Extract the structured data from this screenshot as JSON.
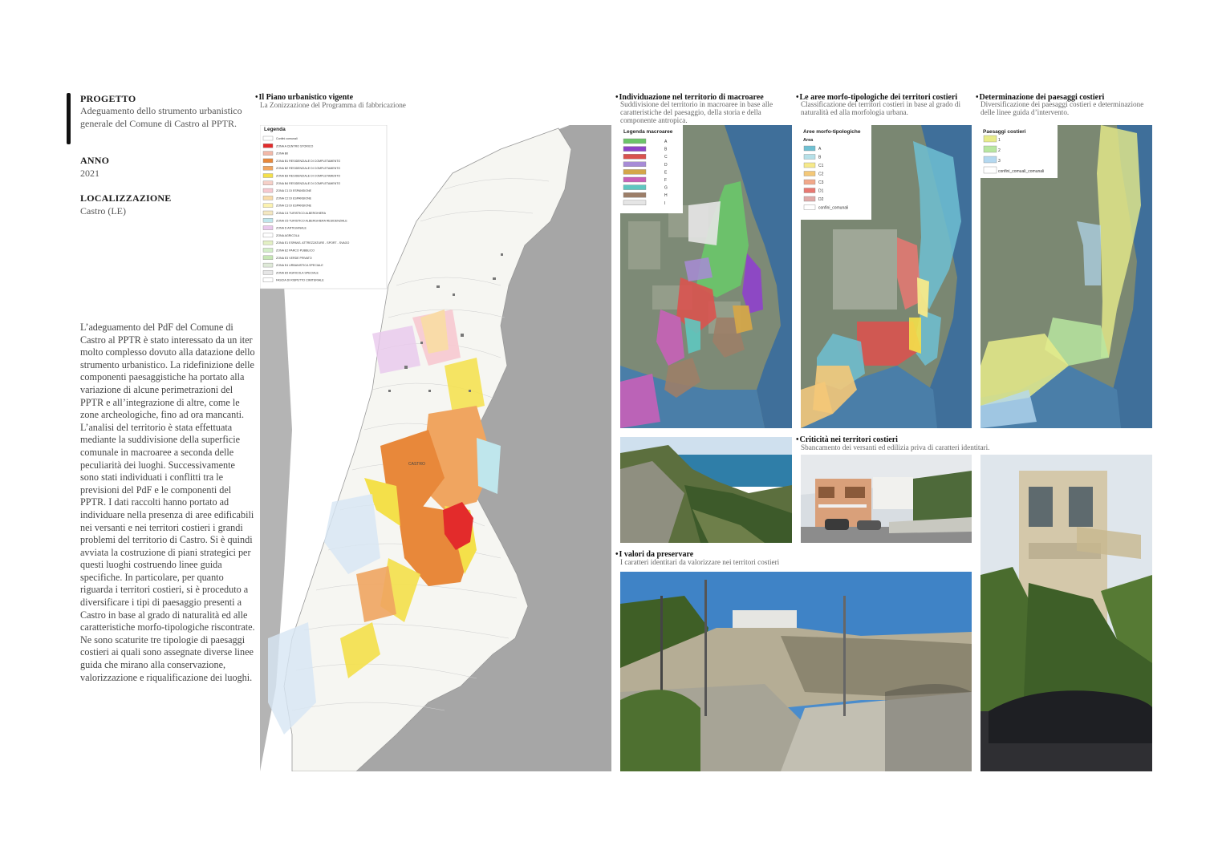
{
  "sidebar": {
    "progetto_label": "PROGETTO",
    "progetto_value": "Adeguamento dello strumento urbanistico generale del Comune di Castro al PPTR.",
    "anno_label": "ANNO",
    "anno_value": "2021",
    "localizzazione_label": "LOCALIZZAZIONE",
    "localizzazione_value": "Castro (LE)",
    "description": "L’adeguamento del PdF del Comune di Castro al PPTR è stato interessato da un iter molto complesso dovuto alla datazione dello strumento urbanistico. La ridefinizione delle componenti paesaggistiche ha portato alla variazione di alcune perimetrazioni del PPTR e all’integrazione di altre, come le zone archeologiche, fino ad ora mancanti. L’analisi del territorio è stata effettuata mediante la suddivisione della superficie comunale in macroaree a seconda delle peculiarità dei luoghi. Successivamente sono stati individuati i conflitti tra le previsioni del PdF e le componenti del PPTR. I dati raccolti hanno portato ad individuare nella presenza di aree edificabili nei versanti e nei territori costieri i grandi problemi del territorio di Castro. Si è quindi avviata la costruzione di piani strategici per questi luoghi costruendo linee guida specifiche. In particolare, per quanto riguarda i territori costieri, si è proceduto a diversificare i tipi di paesaggio presenti a Castro in base al grado di naturalità ed alle caratteristiche morfo-tipologiche riscontrate. Ne sono scaturite tre tipologie di paesaggi costieri ai quali sono assegnate diverse linee guida che mirano alla conservazione, valorizzazione e riqualificazione dei luoghi."
  },
  "piano": {
    "title": "Il Piano urbanistico vigente",
    "subtitle": "La Zonizzazione del Programma di fabbricazione",
    "legend_title": "Legenda",
    "legend_items": [
      {
        "label": "Confini comunali",
        "color": "#ffffff"
      },
      {
        "label": "ZONA A CENTRO STORICO",
        "color": "#e32b2b"
      },
      {
        "label": "ZONA B0",
        "color": "#f2b8a8"
      },
      {
        "label": "ZONA B1 RESIDENZIALE DI COMPLETAMENTO",
        "color": "#e8883a"
      },
      {
        "label": "ZONA B2 RESIDENZIALE DI COMPLETAMENTO",
        "color": "#f0a560"
      },
      {
        "label": "ZONA B3 RESIDENZIALE DI COMPLETAMENTO",
        "color": "#f4e04a"
      },
      {
        "label": "ZONA B4 RESIDENZIALE DI COMPLETAMENTO",
        "color": "#f6d0c8"
      },
      {
        "label": "ZONA C1 DI ESPANSIONE",
        "color": "#f7c9d0"
      },
      {
        "label": "ZONA C2 DI ESPANSIONE",
        "color": "#f9dba8"
      },
      {
        "label": "ZONA C3 DI ESPANSIONE",
        "color": "#fbf2b0"
      },
      {
        "label": "ZONA C4 TURISTICO ALBERGHIERA",
        "color": "#f4e8c2"
      },
      {
        "label": "ZONA C5 TURISTICO ALBERGHIERA RESIDENZIALE",
        "color": "#bfe6ec"
      },
      {
        "label": "ZONA D ARTIGIANALE",
        "color": "#e9c8ec"
      },
      {
        "label": "ZONA AGRICOLA",
        "color": "#ffffff"
      },
      {
        "label": "ZONA E1 ESPANS. ATTREZZATURE - SPORT - SVAGO",
        "color": "#e3f0c4"
      },
      {
        "label": "ZONA E2 PARCO PUBBLICO",
        "color": "#d3eec8"
      },
      {
        "label": "ZONA E3 VERDE PRIVATO",
        "color": "#c6e6b4"
      },
      {
        "label": "ZONA E4 URBANISTICA SPECIALE",
        "color": "#dfead8"
      },
      {
        "label": "ZONA E5 AGRICOLA SPECIALE",
        "color": "#e6e6e6"
      },
      {
        "label": "FASCIA DI RISPETTO CIMITERIALE",
        "color": "#ffffff"
      }
    ],
    "map_label": "CASTRO"
  },
  "macroaree": {
    "title": "Individuazione nel territorio di macroaree",
    "subtitle": "Suddivisione del territorio in macroaree in base alle caratteristiche del paesaggio, della storia e della componente  antropica.",
    "legend_title": "Legenda macroaree",
    "legend_items": [
      {
        "label": "A",
        "color": "#6cc46a"
      },
      {
        "label": "B",
        "color": "#8e44c8"
      },
      {
        "label": "C",
        "color": "#d9534f"
      },
      {
        "label": "D",
        "color": "#a78bd6"
      },
      {
        "label": "E",
        "color": "#d4a64a"
      },
      {
        "label": "F",
        "color": "#c860b8"
      },
      {
        "label": "G",
        "color": "#5fc6c0"
      },
      {
        "label": "H",
        "color": "#9c7e68"
      },
      {
        "label": "I",
        "color": "#e5e5e5"
      }
    ]
  },
  "aree": {
    "title": "Le aree morfo-tipologiche dei territori costieri",
    "subtitle": "Classificazione dei territori costieri in base al grado di naturalità ed alla morfologia urbana.",
    "legend_title": "Aree morfo-tipologiche",
    "legend_subtitle": "Area",
    "legend_items": [
      {
        "label": "A",
        "color": "#6fc0d2"
      },
      {
        "label": "B",
        "color": "#b6e0e8"
      },
      {
        "label": "C1",
        "color": "#f6e98a"
      },
      {
        "label": "C2",
        "color": "#f4c878"
      },
      {
        "label": "C3",
        "color": "#f2a88a"
      },
      {
        "label": "D1",
        "color": "#e87872"
      },
      {
        "label": "D2",
        "color": "#e0aaa8"
      },
      {
        "label": "confini_comunali",
        "color": "#ffffff"
      }
    ]
  },
  "paesaggi": {
    "title": "Determinazione dei paesaggi costieri",
    "subtitle": "Diversificazione dei paesaggi costieri e determinazione delle linee guida d’intervento.",
    "legend_title": "Paesaggi costieri",
    "legend_items": [
      {
        "label": "1",
        "color": "#e8ec8a"
      },
      {
        "label": "2",
        "color": "#b8e6a0"
      },
      {
        "label": "3",
        "color": "#b4d8f0"
      },
      {
        "label": "confini_comuali_comunali",
        "color": "#ffffff"
      }
    ]
  },
  "criticita": {
    "title": "Criticità nei territori costieri",
    "subtitle": "Sbancamento dei versanti ed edilizia priva di caratteri identitari."
  },
  "valori": {
    "title": "I valori da preservare",
    "subtitle": "I caratteri identitari da valorizzare nei territori costieri"
  }
}
